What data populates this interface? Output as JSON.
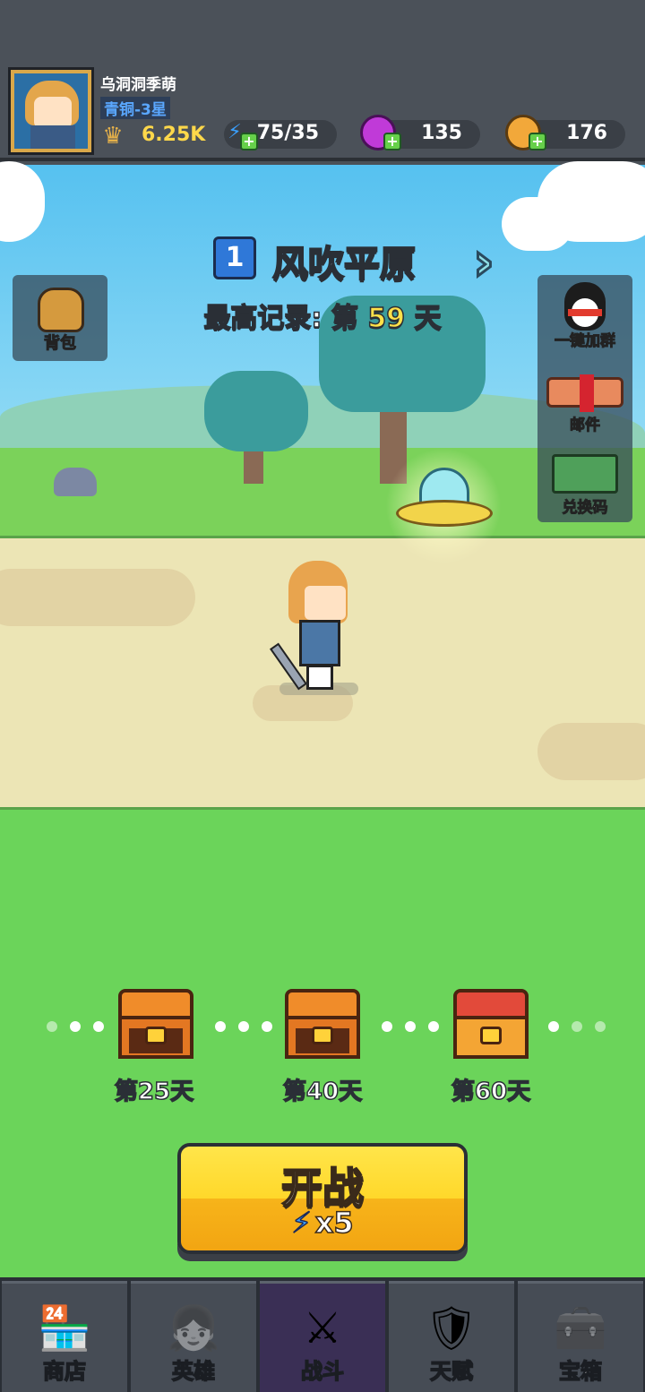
{
  "player": {
    "name": "乌洞洞季萌",
    "rank": "青铜-3星",
    "power": "6.25K"
  },
  "resources": {
    "energy": "75/35",
    "gems": "135",
    "coins": "176"
  },
  "stage": {
    "number": "1",
    "name": "风吹平原",
    "record_prefix": "最高记录: 第",
    "record_day": "59",
    "record_suffix": "天"
  },
  "side_buttons": {
    "bag": "背包",
    "join_group": "一键加群",
    "mail": "邮件",
    "redeem_code": "兑换码"
  },
  "milestones": [
    {
      "label": "第25天"
    },
    {
      "label": "第40天"
    },
    {
      "label": "第60天"
    }
  ],
  "fight_button": {
    "label": "开战",
    "cost": "x5"
  },
  "nav": [
    {
      "label": "商店"
    },
    {
      "label": "英雄"
    },
    {
      "label": "战斗"
    },
    {
      "label": "天赋"
    },
    {
      "label": "宝箱"
    }
  ],
  "colors": {
    "accent_yellow": "#ffd82a",
    "energy_blue": "#3aa0ff",
    "gem_purple": "#c03ad8",
    "coin_gold": "#f2a83a",
    "grass": "#6bd45a"
  }
}
